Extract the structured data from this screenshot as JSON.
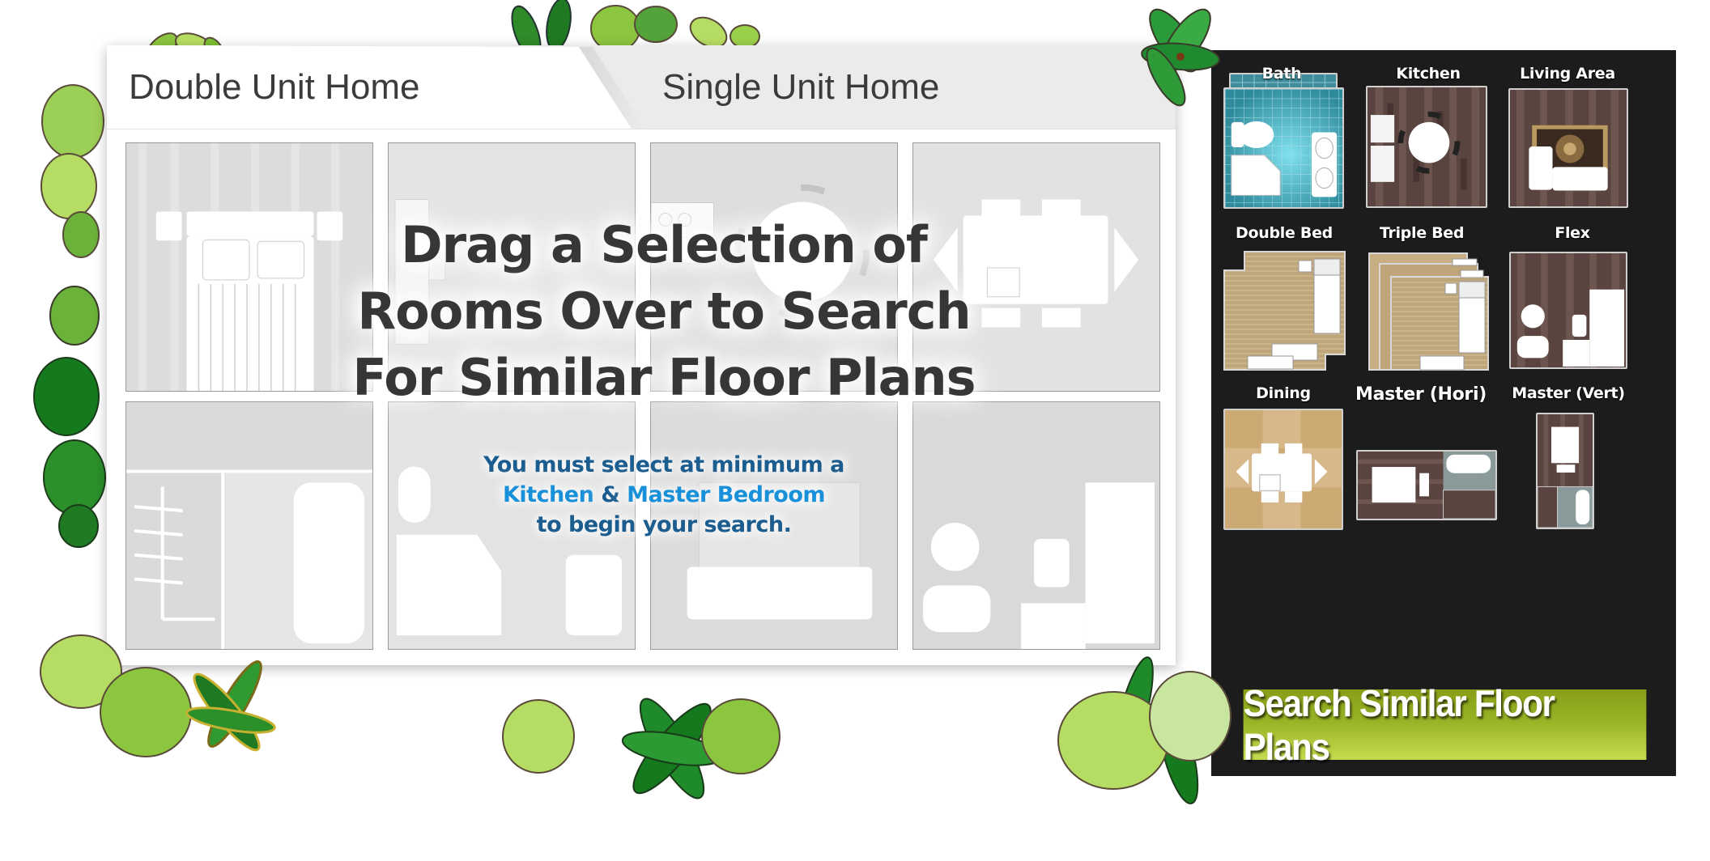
{
  "tabs": {
    "double_unit": "Double Unit Home",
    "single_unit": "Single Unit Home",
    "active": "double_unit"
  },
  "overlay": {
    "headline_lines": [
      "Drag a Selection of",
      "Rooms Over to Search",
      "For Similar Floor Plans"
    ],
    "sub_line1": "You must select at minimum a",
    "sub_kitchen": "Kitchen",
    "sub_amp": "&",
    "sub_master": "Master Bedroom",
    "sub_line3": "to begin your search."
  },
  "drop_grid": {
    "slots": [
      {
        "room": "Master Bedroom"
      },
      {
        "room": "Triple Bed"
      },
      {
        "room": "Kitchen"
      },
      {
        "room": "Dining"
      },
      {
        "room": "Master Closet & Bath"
      },
      {
        "room": "Bath"
      },
      {
        "room": "Living Area"
      },
      {
        "room": "Flex"
      }
    ]
  },
  "room_palette": {
    "rooms": [
      {
        "label": "Bath",
        "icon": "bath-tile-icon"
      },
      {
        "label": "Kitchen",
        "icon": "kitchen-icon"
      },
      {
        "label": "Living Area",
        "icon": "living-area-icon"
      },
      {
        "label": "Double Bed",
        "icon": "double-bed-icon"
      },
      {
        "label": "Triple Bed",
        "icon": "triple-bed-icon"
      },
      {
        "label": "Flex",
        "icon": "flex-room-icon"
      },
      {
        "label": "Dining",
        "icon": "dining-icon"
      },
      {
        "label": "Master (Hori)",
        "icon": "master-horizontal-icon"
      },
      {
        "label": "Master (Vert)",
        "icon": "master-vertical-icon"
      }
    ]
  },
  "search_button": {
    "label": "Search Similar Floor Plans"
  },
  "colors": {
    "panel_bg": "#1c1c1c",
    "button_top": "#879f18",
    "button_bottom": "#c6dc4e",
    "headline": "#363636",
    "sub_text": "#1c5d90",
    "highlight": "#1990da",
    "inactive_tab": "#ebebeb"
  }
}
